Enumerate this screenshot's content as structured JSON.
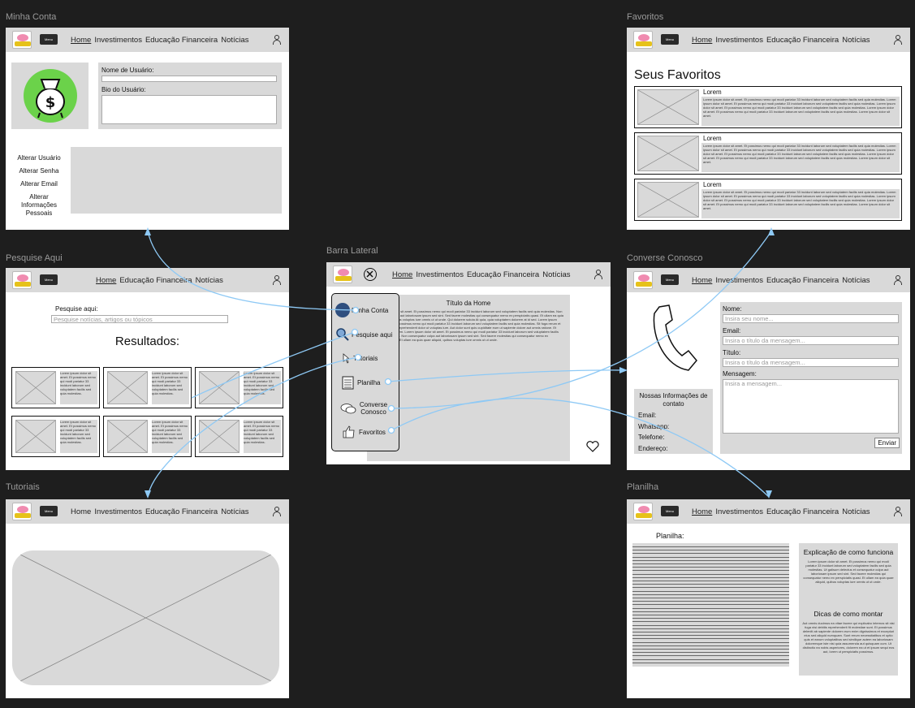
{
  "frames": {
    "minha_conta": "Minha Conta",
    "favoritos": "Favoritos",
    "pesquise_aqui": "Pesquise Aqui",
    "barra_lateral": "Barra Lateral",
    "converse_conosco": "Converse Conosco",
    "tutoriais": "Tutoriais",
    "planilha": "Planilha"
  },
  "nav": {
    "menu": "Menu",
    "home": "Home",
    "investimentos": "Investimentos",
    "educacao": "Educação Financeira",
    "noticias": "Notícias"
  },
  "minha_conta": {
    "nome_label": "Nome de Usuário:",
    "bio_label": "Bio do Usuário:",
    "options": [
      "Alterar Usuário",
      "Alterar Senha",
      "Alterar Email",
      "Alterar Informações Pessoais"
    ]
  },
  "favoritos": {
    "title": "Seus Favoritos",
    "item_title": "Lorem",
    "item_text": "Lorem ipsum dolor sit amet. Et possimus nemo qui modi pariatur 33 incidunt laborum sed voluptatem facilis sed quia molestias. Lorem ipsum dolor sit amet. Et possimus nemo qui modi pariatur 33 incidunt laborum sed voluptatem facilis sed quia molestias. Lorem ipsum dolor sit amet. Et possimus nemo qui modi pariatur 33 incidunt laborum sed voluptatem facilis sed quia molestias. Lorem ipsum dolor sit amet. Et possimus nemo qui modi pariatur 33 incidunt laborum sed voluptatem facilis sed quia molestias. Lorem ipsum dolor sit amet."
  },
  "pesquise": {
    "label": "Pesquise aqui:",
    "placeholder": "Pesquise notícias, artigos ou tópicos",
    "results": "Resultados:",
    "card_text": "Lorem ipsum dolor sit amet. Et possimus nemo qui modi pariatur 33 incidunt laborum sed voluptatem facilis sed quia molestias."
  },
  "barra_lateral": {
    "items": [
      "Minha Conta",
      "Pesquise aqui",
      "Tutoriais",
      "Planilha",
      "Converse Conosco",
      "Favoritos"
    ],
    "home_title": "Título da Home",
    "home_text": "Lorem ipsum dolor sit amet. Et possimus nemo qui modi pariatur 33 incidunt laborum sed voluptatem facilis sed quia molestias. Non consequatur culpa aut laboriosam ipsum sed sint. Sed facere molestias qui consequatur nemo ex perspiciatis quasi. Et ullam ea quia quae aliquid, quibus voluptas iure omnis ut ut unde. Qui dolorem soluta At quia, quia voluptatem dolorem at id sed. Lorem ipsum dolor sit amet. Et possimus nemo qui modi pariatur 33 incidunt laborum sed voluptatem facilis sed quia molestias. Sit fuga rerum et repellat rerum ex reprehenderit dolor ut voluptas iure. Aut dolor sunt quis cupiditate eum ut sapiente dolore aut omnis ratione. Et impedit odit ut autem. Lorem ipsum dolor sit amet. Et possimus nemo qui modi pariatur 33 incidunt laborum sed voluptatem facilis sed quia molestias. Non consequatur culpa aut laboriosam ipsum sed sint. Sed facere molestias qui consequatur nemo ex perspiciatis quasi. Et ullam ea quia quae aliquid, quibus voluptas iure omnis ut ut unde."
  },
  "converse": {
    "nome_label": "Nome:",
    "nome_ph": "Insira seu nome...",
    "email_label": "Email:",
    "email_ph": "Insira o título da mensagem...",
    "titulo_label": "Título:",
    "titulo_ph": "Insira o título da mensagem...",
    "mensagem_label": "Mensagem:",
    "mensagem_ph": "Insira a mensagem...",
    "info_title": "Nossas Informações de contato",
    "info_fields": [
      "Email:",
      "Whatsapp:",
      "Telefone:",
      "Endereço:"
    ],
    "enviar": "Enviar"
  },
  "planilha": {
    "label": "Planilha:",
    "explicacao_title": "Explicação de como funciona",
    "explicacao_text": "Lorem ipsum dolor sit amet. Et possimus nemo qui modi pariatur 33 incidunt laborum sed voluptatem facilis sed quia molestias. Ut galisum delectus et consequatur culpa aut laboriosam ipsum sed sint. Sed facere molestias qui consequatur nemo ex perspiciatis quasi. Et ullam ea quia quae aliquid, quibus voluptas iure omnis ut ut unde.",
    "dicas_title": "Dicas de como montar",
    "dicas_text": "Aut omnis ducimus ea vitae facere qui explicabo internos sit nisi fuga nisi debitis reprehenderit fit molestiae sunt. Et possimus deleniti ab sapiente dolorem eum enim dignissimos et excepturi eius sed aliquid numquam. Sunt rerum necessitatibus et optio quis et earum voluptatibus sed similique autem ea laboriosam doloremque iste nisi quia assumenda aut quisquam cum. Ut distinctio ea nobis asperiores, dolorem ea ut et ipsum sequi eos aut, lorem ut perspiciatis possimus."
  }
}
